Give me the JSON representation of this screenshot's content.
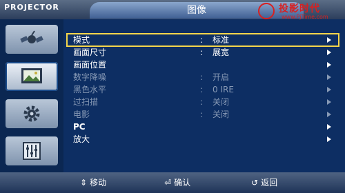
{
  "brand": "PROJECTOR",
  "title": "图像",
  "watermark": {
    "text": "投影时代",
    "url": "www.PjTime.com"
  },
  "sidebar": {
    "items": [
      {
        "icon": "satellite-icon",
        "active": false
      },
      {
        "icon": "picture-icon",
        "active": true
      },
      {
        "icon": "gear-icon",
        "active": false
      },
      {
        "icon": "sliders-icon",
        "active": false
      }
    ]
  },
  "menu": {
    "rows": [
      {
        "label": "模式",
        "colon": ":",
        "value": "标准",
        "arrow": true,
        "dim": false,
        "selected": true
      },
      {
        "label": "画面尺寸",
        "colon": ":",
        "value": "展宽",
        "arrow": true,
        "dim": false,
        "selected": false
      },
      {
        "label": "画面位置",
        "colon": "",
        "value": "",
        "arrow": true,
        "dim": false,
        "selected": false
      },
      {
        "label": "数字降噪",
        "colon": ":",
        "value": "开启",
        "arrow": true,
        "dim": true,
        "selected": false
      },
      {
        "label": "黑色水平",
        "colon": ":",
        "value": "0 IRE",
        "arrow": true,
        "dim": true,
        "selected": false
      },
      {
        "label": "过扫描",
        "colon": ":",
        "value": "关闭",
        "arrow": true,
        "dim": true,
        "selected": false
      },
      {
        "label": "电影",
        "colon": ":",
        "value": "关闭",
        "arrow": true,
        "dim": true,
        "selected": false
      },
      {
        "label": "PC",
        "colon": "",
        "value": "",
        "arrow": true,
        "dim": false,
        "selected": false
      },
      {
        "label": "放大",
        "colon": "",
        "value": "",
        "arrow": true,
        "dim": false,
        "selected": false
      }
    ]
  },
  "footer": {
    "move": "移动",
    "move_icon": "updown-icon",
    "confirm": "确认",
    "confirm_icon": "enter-icon",
    "back": "返回",
    "back_icon": "return-icon"
  },
  "colors": {
    "background": "#0d2e63",
    "selection": "#f5d64a",
    "dim_text": "#8799b5"
  }
}
